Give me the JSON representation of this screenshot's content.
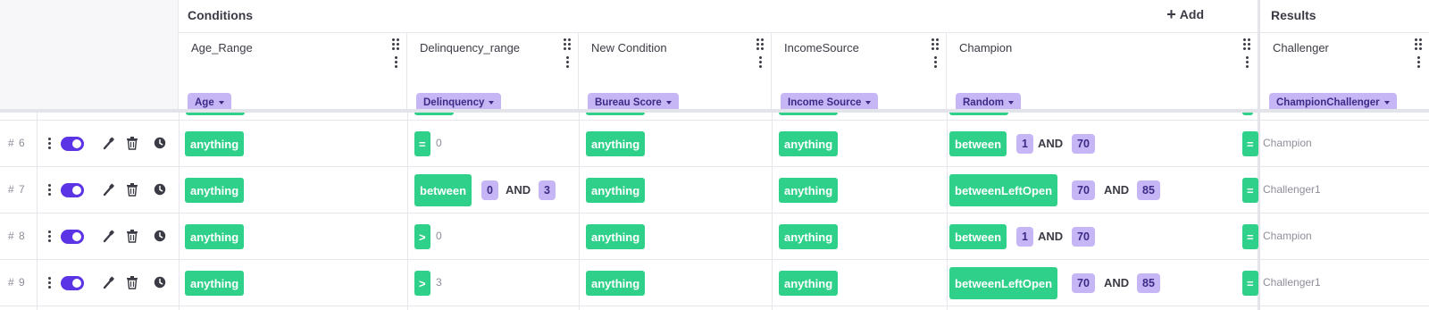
{
  "header": {
    "conditions_title": "Conditions",
    "add_label": "Add",
    "results_title": "Results"
  },
  "columns": [
    {
      "name": "Age_Range",
      "tag": "Age"
    },
    {
      "name": "Delinquency_range",
      "tag": "Delinquency"
    },
    {
      "name": "New Condition",
      "tag": "Bureau Score"
    },
    {
      "name": "IncomeSource",
      "tag": "Income Source"
    },
    {
      "name": "Champion",
      "tag": "Random"
    },
    {
      "name": "Challenger",
      "tag": "ChampionChallenger"
    }
  ],
  "rows": [
    {
      "num": "# 6",
      "age": "anything",
      "delinq": {
        "op": "=",
        "value": "0"
      },
      "bureau": "anything",
      "income": "anything",
      "champion": {
        "op": "between",
        "from": "1",
        "and": "AND",
        "to": "70"
      },
      "result": {
        "op": "=",
        "value": "Champion"
      }
    },
    {
      "num": "# 7",
      "age": "anything",
      "delinq": {
        "op": "between",
        "from": "0",
        "and": "AND",
        "to": "3"
      },
      "bureau": "anything",
      "income": "anything",
      "champion": {
        "op": "betweenLeftOpen",
        "from": "70",
        "and": "AND",
        "to": "85"
      },
      "result": {
        "op": "=",
        "value": "Challenger1"
      }
    },
    {
      "num": "# 8",
      "age": "anything",
      "delinq": {
        "op": ">",
        "value": "0"
      },
      "bureau": "anything",
      "income": "anything",
      "champion": {
        "op": "between",
        "from": "1",
        "and": "AND",
        "to": "70"
      },
      "result": {
        "op": "=",
        "value": "Champion"
      }
    },
    {
      "num": "# 9",
      "age": "anything",
      "delinq": {
        "op": ">",
        "value": "3"
      },
      "bureau": "anything",
      "income": "anything",
      "champion": {
        "op": "betweenLeftOpen",
        "from": "70",
        "and": "AND",
        "to": "85"
      },
      "result": {
        "op": "=",
        "value": "Challenger1"
      }
    }
  ],
  "icons": [
    "drag-grip-icon",
    "more-vertical-icon",
    "caret-down-icon",
    "plus-icon",
    "toggle-switch",
    "wand-icon",
    "trash-icon",
    "clock-icon"
  ],
  "colors": {
    "green": "#2fd089",
    "lavender": "#c6b6f5",
    "violet": "#5b34e6",
    "text": "#3b3b45"
  }
}
